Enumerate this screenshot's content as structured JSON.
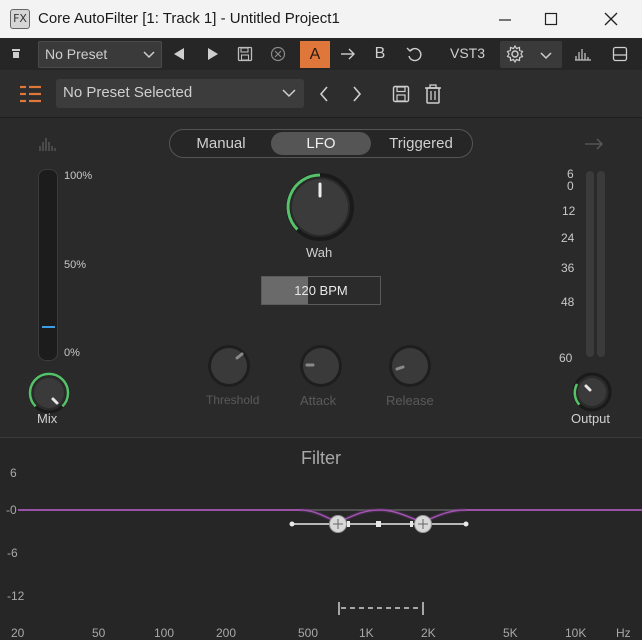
{
  "window": {
    "icon_text": "FX",
    "title": "Core AutoFilter [1: Track 1] - Untitled Project1"
  },
  "host_toolbar": {
    "preset_value": "No Preset",
    "ab_active": "A",
    "ab_other": "B",
    "format": "VST3"
  },
  "plugin_bar": {
    "preset_value": "No Preset Selected"
  },
  "mode": {
    "tabs": [
      "Manual",
      "LFO",
      "Triggered"
    ],
    "selected": "LFO"
  },
  "mix": {
    "label": "Mix",
    "scale": [
      "100%",
      "50%",
      "0%"
    ],
    "meter_level": 0.16
  },
  "wah": {
    "label": "Wah"
  },
  "tempo": {
    "text": "120 BPM",
    "fill": 0.39
  },
  "dynamics": {
    "threshold": "Threshold",
    "attack": "Attack",
    "release": "Release"
  },
  "output": {
    "label": "Output",
    "scale": [
      "6",
      "0",
      "12",
      "24",
      "36",
      "48",
      "60"
    ]
  },
  "filter": {
    "title": "Filter",
    "y_labels": [
      "6",
      "-0",
      "-6",
      "-12"
    ],
    "x_labels": [
      "20",
      "50",
      "100",
      "200",
      "500",
      "1K",
      "2K",
      "5K",
      "10K",
      "Hz"
    ],
    "curve_color": "#c060d0"
  },
  "colors": {
    "accent": "#e0773a",
    "knob_ring": "#55c26a",
    "meter_mark": "#3c9ce6"
  }
}
